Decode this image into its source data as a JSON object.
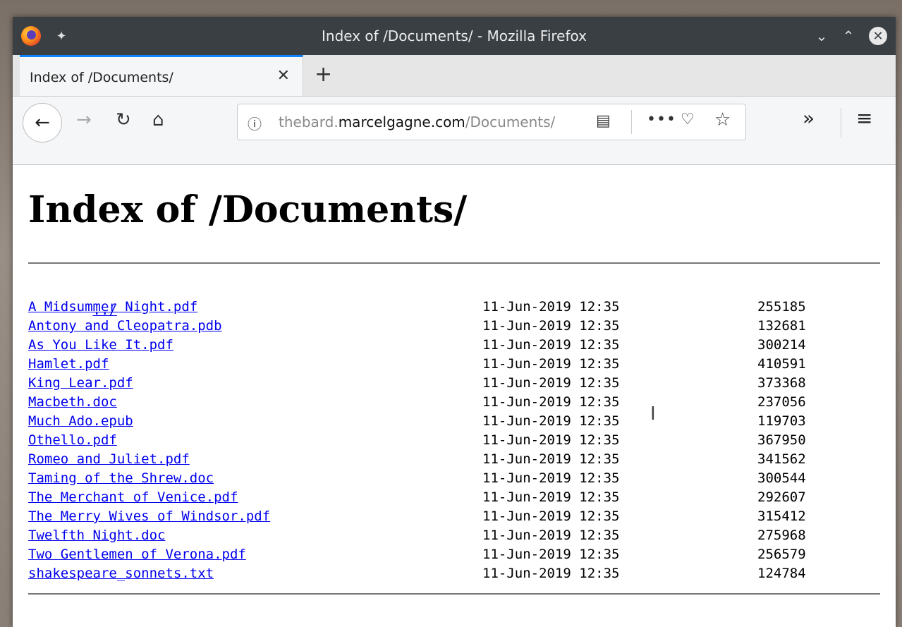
{
  "window": {
    "title": "Index of /Documents/ - Mozilla Firefox"
  },
  "tab": {
    "title": "Index of /Documents/"
  },
  "urlbar": {
    "prefix": "thebard.",
    "domain": "marcelgagne.com",
    "path": "/Documents/"
  },
  "page": {
    "heading": "Index of /Documents/",
    "parent_link": "../",
    "files": [
      {
        "name": "A Midsummer Night.pdf",
        "date": "11-Jun-2019 12:35",
        "size": "255185"
      },
      {
        "name": "Antony and Cleopatra.pdb",
        "date": "11-Jun-2019 12:35",
        "size": "132681"
      },
      {
        "name": "As You Like It.pdf",
        "date": "11-Jun-2019 12:35",
        "size": "300214"
      },
      {
        "name": "Hamlet.pdf",
        "date": "11-Jun-2019 12:35",
        "size": "410591"
      },
      {
        "name": "King Lear.pdf",
        "date": "11-Jun-2019 12:35",
        "size": "373368"
      },
      {
        "name": "Macbeth.doc",
        "date": "11-Jun-2019 12:35",
        "size": "237056"
      },
      {
        "name": "Much Ado.epub",
        "date": "11-Jun-2019 12:35",
        "size": "119703"
      },
      {
        "name": "Othello.pdf",
        "date": "11-Jun-2019 12:35",
        "size": "367950"
      },
      {
        "name": "Romeo and Juliet.pdf",
        "date": "11-Jun-2019 12:35",
        "size": "341562"
      },
      {
        "name": "Taming of the Shrew.doc",
        "date": "11-Jun-2019 12:35",
        "size": "300544"
      },
      {
        "name": "The Merchant of Venice.pdf",
        "date": "11-Jun-2019 12:35",
        "size": "292607"
      },
      {
        "name": "The Merry Wives of Windsor.pdf",
        "date": "11-Jun-2019 12:35",
        "size": "315412"
      },
      {
        "name": "Twelfth Night.doc",
        "date": "11-Jun-2019 12:35",
        "size": "275968"
      },
      {
        "name": "Two Gentlemen of Verona.pdf",
        "date": "11-Jun-2019 12:35",
        "size": "256579"
      },
      {
        "name": "shakespeare_sonnets.txt",
        "date": "11-Jun-2019 12:35",
        "size": "124784"
      }
    ]
  },
  "icons": {
    "app": "firefox-icon",
    "pin": "pin-icon",
    "minimize": "chevron-down-icon",
    "maximize": "chevron-up-icon",
    "close": "close-icon",
    "back": "back-arrow-icon",
    "forward": "forward-arrow-icon",
    "reload": "reload-icon",
    "home": "home-icon",
    "info": "info-icon",
    "reader": "reader-view-icon",
    "more": "more-actions-icon",
    "pocket": "pocket-icon",
    "bookmark": "star-icon",
    "overflow": "overflow-chevron-icon",
    "menu": "hamburger-menu-icon"
  },
  "colors": {
    "titlebar": "#3a3f44",
    "tab_accent": "#0a84ff",
    "link": "#0000ee"
  }
}
